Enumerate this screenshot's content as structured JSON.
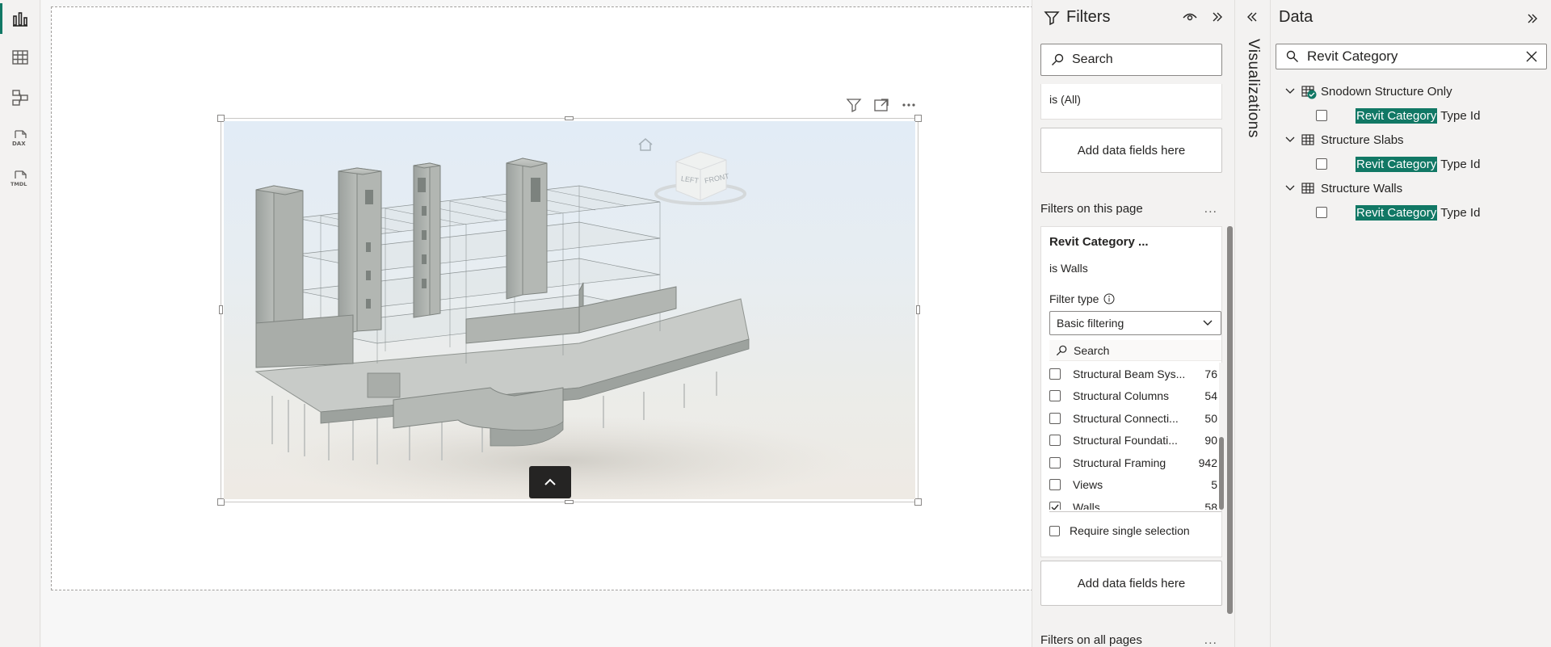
{
  "nav": {
    "items": [
      {
        "name": "report-view"
      },
      {
        "name": "table-view"
      },
      {
        "name": "model-view"
      },
      {
        "name": "dax-query-view",
        "label": "DAX"
      },
      {
        "name": "tmdl-view",
        "label": "TMDL"
      }
    ]
  },
  "filters": {
    "title": "Filters",
    "search_placeholder": "Search",
    "visual_filter_value": "is (All)",
    "add_fields_label": "Add data fields here",
    "section_page": "Filters on this page",
    "section_all": "Filters on all pages",
    "more_label": "...",
    "card": {
      "title": "Revit Category ...",
      "summary": "is Walls",
      "filter_type_label": "Filter type",
      "filter_type_value": "Basic filtering",
      "search_placeholder": "Search",
      "items": [
        {
          "name": "Structural Beam Sys...",
          "count": "76",
          "checked": false
        },
        {
          "name": "Structural Columns",
          "count": "54",
          "checked": false
        },
        {
          "name": "Structural Connecti...",
          "count": "50",
          "checked": false
        },
        {
          "name": "Structural Foundati...",
          "count": "90",
          "checked": false
        },
        {
          "name": "Structural Framing",
          "count": "942",
          "checked": false
        },
        {
          "name": "Views",
          "count": "5",
          "checked": false
        },
        {
          "name": "Walls",
          "count": "58",
          "checked": true
        }
      ],
      "require_single": "Require single selection"
    },
    "add_fields_label_2": "Add data fields here"
  },
  "viewer": {
    "cube_left": "LEFT",
    "cube_front": "FRONT"
  },
  "visualizations": {
    "label": "Visualizations"
  },
  "data": {
    "title": "Data",
    "search_value": "Revit Category",
    "tables": [
      {
        "name": "Snodown Structure Only",
        "field_match": "Revit Category",
        "field_rest": "Type Id"
      },
      {
        "name": "Structure Slabs",
        "field_match": "Revit Category",
        "field_rest": "Type Id"
      },
      {
        "name": "Structure Walls",
        "field_match": "Revit Category",
        "field_rest": "Type Id"
      }
    ]
  },
  "colors": {
    "accent": "#117865",
    "pane_bg": "#f3f2f1",
    "canvas_bg": "#ffffff"
  }
}
